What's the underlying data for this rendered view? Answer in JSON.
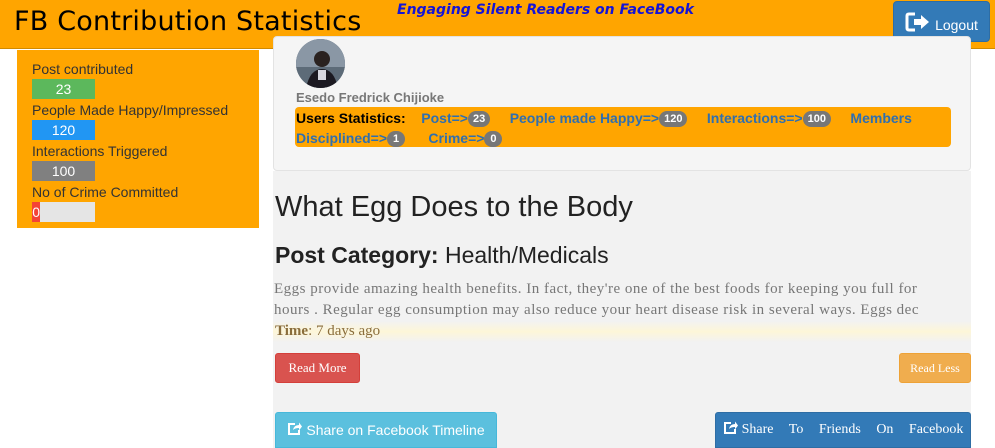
{
  "header": {
    "app_title": "FB Contribution Statistics",
    "tagline": "Engaging Silent Readers on FaceBook",
    "logout_label": "Logout",
    "logout_icon": "logout-icon",
    "bar_color": "#ffa500"
  },
  "stats": {
    "items": [
      {
        "label": "Post contributed",
        "value": "23",
        "fill_fraction": 1.0,
        "color": "#5cb85c"
      },
      {
        "label": "People Made Happy/Impressed",
        "value": "120",
        "fill_fraction": 1.0,
        "color": "#2196f3"
      },
      {
        "label": "Interactions Triggered",
        "value": "100",
        "fill_fraction": 1.0,
        "color": "#808080"
      },
      {
        "label": "No of Crime Committed",
        "value": "0",
        "fill_fraction": 0.13,
        "color": "#f44336"
      }
    ]
  },
  "profile": {
    "name": "Esedo Fredrick Chijioke",
    "stats_label": "Users Statistics:",
    "post_label": "Post=>",
    "post_value": "23",
    "happy_label": "People made Happy=>",
    "happy_value": "120",
    "interactions_label": "Interactions=>",
    "interactions_value": "100",
    "members_label": "Members",
    "disciplined_label": "Disciplined=>",
    "disciplined_value": "1",
    "crime_label": "Crime=>",
    "crime_value": "0"
  },
  "post": {
    "title": "What Egg Does to the Body",
    "category_label": "Post Category:",
    "category_value": "Health/Medicals",
    "excerpt_line1": "Eggs provide amazing health benefits. In fact, they're one of the best foods for keeping you full for",
    "excerpt_line2": "hours . Regular egg consumption may also reduce your heart disease risk in several ways. Eggs dec",
    "time_label": "Time",
    "time_value": ": 7 days ago",
    "read_more_label": "Read More",
    "read_less_label": "Read Less",
    "share_timeline_label": "Share on Facebook Timeline",
    "share_friends_label": "Share To Friends On Facebook",
    "share_icon": "share-icon"
  }
}
